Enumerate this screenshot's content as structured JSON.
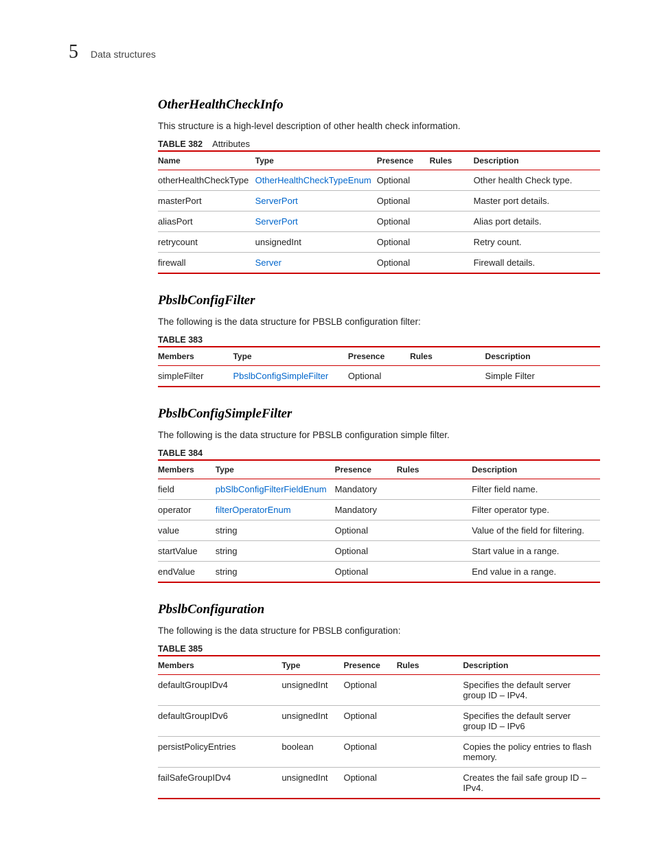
{
  "header": {
    "chapter_number": "5",
    "chapter_title": "Data structures"
  },
  "sections": [
    {
      "title": "OtherHealthCheckInfo",
      "intro": "This structure is a high-level description of other health check information.",
      "table_label": "TABLE 382",
      "table_sub": "Attributes",
      "columns": [
        "Name",
        "Type",
        "Presence",
        "Rules",
        "Description"
      ],
      "col_widths": [
        "22%",
        "27%",
        "12%",
        "10%",
        "29%"
      ],
      "rows": [
        {
          "c0": "otherHealthCheckType",
          "c1": "OtherHealthCheckTypeEnum",
          "c1_link": true,
          "c2": "Optional",
          "c3": "",
          "c4": "Other health Check type."
        },
        {
          "c0": "masterPort",
          "c1": "ServerPort",
          "c1_link": true,
          "c2": "Optional",
          "c3": "",
          "c4": "Master port details."
        },
        {
          "c0": "aliasPort",
          "c1": "ServerPort",
          "c1_link": true,
          "c2": "Optional",
          "c3": "",
          "c4": "Alias port details."
        },
        {
          "c0": "retrycount",
          "c1": "unsignedInt",
          "c1_link": false,
          "c2": "Optional",
          "c3": "",
          "c4": "Retry count."
        },
        {
          "c0": "firewall",
          "c1": "Server",
          "c1_link": true,
          "c2": "Optional",
          "c3": "",
          "c4": "Firewall details."
        }
      ]
    },
    {
      "title": "PbslbConfigFilter",
      "intro": "The following is the data structure for PBSLB configuration filter:",
      "table_label": "TABLE 383",
      "table_sub": "",
      "columns": [
        "Members",
        "Type",
        "Presence",
        "Rules",
        "Description"
      ],
      "col_widths": [
        "17%",
        "26%",
        "14%",
        "17%",
        "26%"
      ],
      "rows": [
        {
          "c0": "simpleFilter",
          "c1": "PbslbConfigSimpleFilter",
          "c1_link": true,
          "c2": "Optional",
          "c3": "",
          "c4": "Simple Filter"
        }
      ]
    },
    {
      "title": "PbslbConfigSimpleFilter",
      "intro": "The following is the data structure for PBSLB configuration simple filter.",
      "table_label": "TABLE 384",
      "table_sub": "",
      "columns": [
        "Members",
        "Type",
        "Presence",
        "Rules",
        "Description"
      ],
      "col_widths": [
        "13%",
        "27%",
        "14%",
        "17%",
        "29%"
      ],
      "rows": [
        {
          "c0": "field",
          "c1": "pbSlbConfigFilterFieldEnum",
          "c1_link": true,
          "c2": "Mandatory",
          "c3": "",
          "c4": "Filter field name."
        },
        {
          "c0": "operator",
          "c1": "filterOperatorEnum",
          "c1_link": true,
          "c2": "Mandatory",
          "c3": "",
          "c4": "Filter operator type."
        },
        {
          "c0": "value",
          "c1": "string",
          "c1_link": false,
          "c2": "Optional",
          "c3": "",
          "c4": "Value of the field for filtering."
        },
        {
          "c0": "startValue",
          "c1": "string",
          "c1_link": false,
          "c2": "Optional",
          "c3": "",
          "c4": "Start value in a range."
        },
        {
          "c0": "endValue",
          "c1": "string",
          "c1_link": false,
          "c2": "Optional",
          "c3": "",
          "c4": "End value in a range."
        }
      ]
    },
    {
      "title": "PbslbConfiguration",
      "intro": "The following is the data structure for PBSLB configuration:",
      "table_label": "TABLE 385",
      "table_sub": "",
      "columns": [
        "Members",
        "Type",
        "Presence",
        "Rules",
        "Description"
      ],
      "col_widths": [
        "28%",
        "14%",
        "12%",
        "15%",
        "31%"
      ],
      "rows": [
        {
          "c0": "defaultGroupIDv4",
          "c1": "unsignedInt",
          "c1_link": false,
          "c2": "Optional",
          "c3": "",
          "c4": "Specifies the default server group ID – IPv4."
        },
        {
          "c0": "defaultGroupIDv6",
          "c1": "unsignedInt",
          "c1_link": false,
          "c2": "Optional",
          "c3": "",
          "c4": "Specifies the default server group ID – IPv6"
        },
        {
          "c0": "persistPolicyEntries",
          "c1": "boolean",
          "c1_link": false,
          "c2": "Optional",
          "c3": "",
          "c4": "Copies the policy entries to flash memory."
        },
        {
          "c0": "failSafeGroupIDv4",
          "c1": "unsignedInt",
          "c1_link": false,
          "c2": "Optional",
          "c3": "",
          "c4": "Creates the fail safe group ID – IPv4."
        }
      ]
    }
  ]
}
